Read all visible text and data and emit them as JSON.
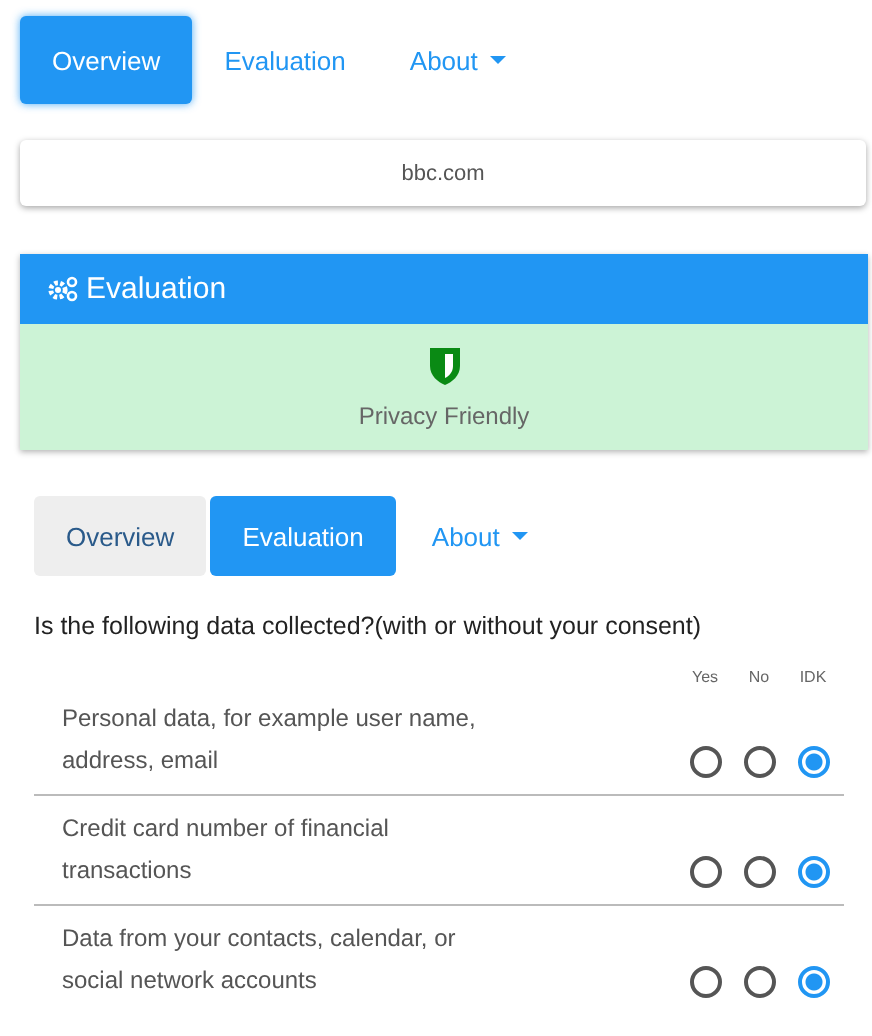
{
  "top_tabs": [
    {
      "label": "Overview",
      "selected": true,
      "kind": "tab"
    },
    {
      "label": "Evaluation",
      "selected": false,
      "kind": "tab"
    },
    {
      "label": "About",
      "selected": false,
      "kind": "dropdown"
    }
  ],
  "domain": "bbc.com",
  "evaluation": {
    "title": "Evaluation",
    "verdict": "Privacy Friendly"
  },
  "section_tabs": [
    {
      "label": "Overview",
      "selected": false,
      "kind": "tab"
    },
    {
      "label": "Evaluation",
      "selected": true,
      "kind": "tab"
    },
    {
      "label": "About",
      "selected": false,
      "kind": "dropdown"
    }
  ],
  "question": "Is the following data collected?(with or without your consent)",
  "answer_columns": [
    "Yes",
    "No",
    "IDK"
  ],
  "items": [
    {
      "text": "Personal data, for example user name, address, email",
      "answers": [
        {
          "selected": false
        },
        {
          "selected": false
        },
        {
          "selected": true
        }
      ]
    },
    {
      "text": "Credit card number of financial transactions",
      "answers": [
        {
          "selected": false
        },
        {
          "selected": false
        },
        {
          "selected": true
        }
      ]
    },
    {
      "text": "Data from your contacts, calendar, or social network accounts",
      "answers": [
        {
          "selected": false
        },
        {
          "selected": false
        },
        {
          "selected": true
        }
      ]
    }
  ]
}
